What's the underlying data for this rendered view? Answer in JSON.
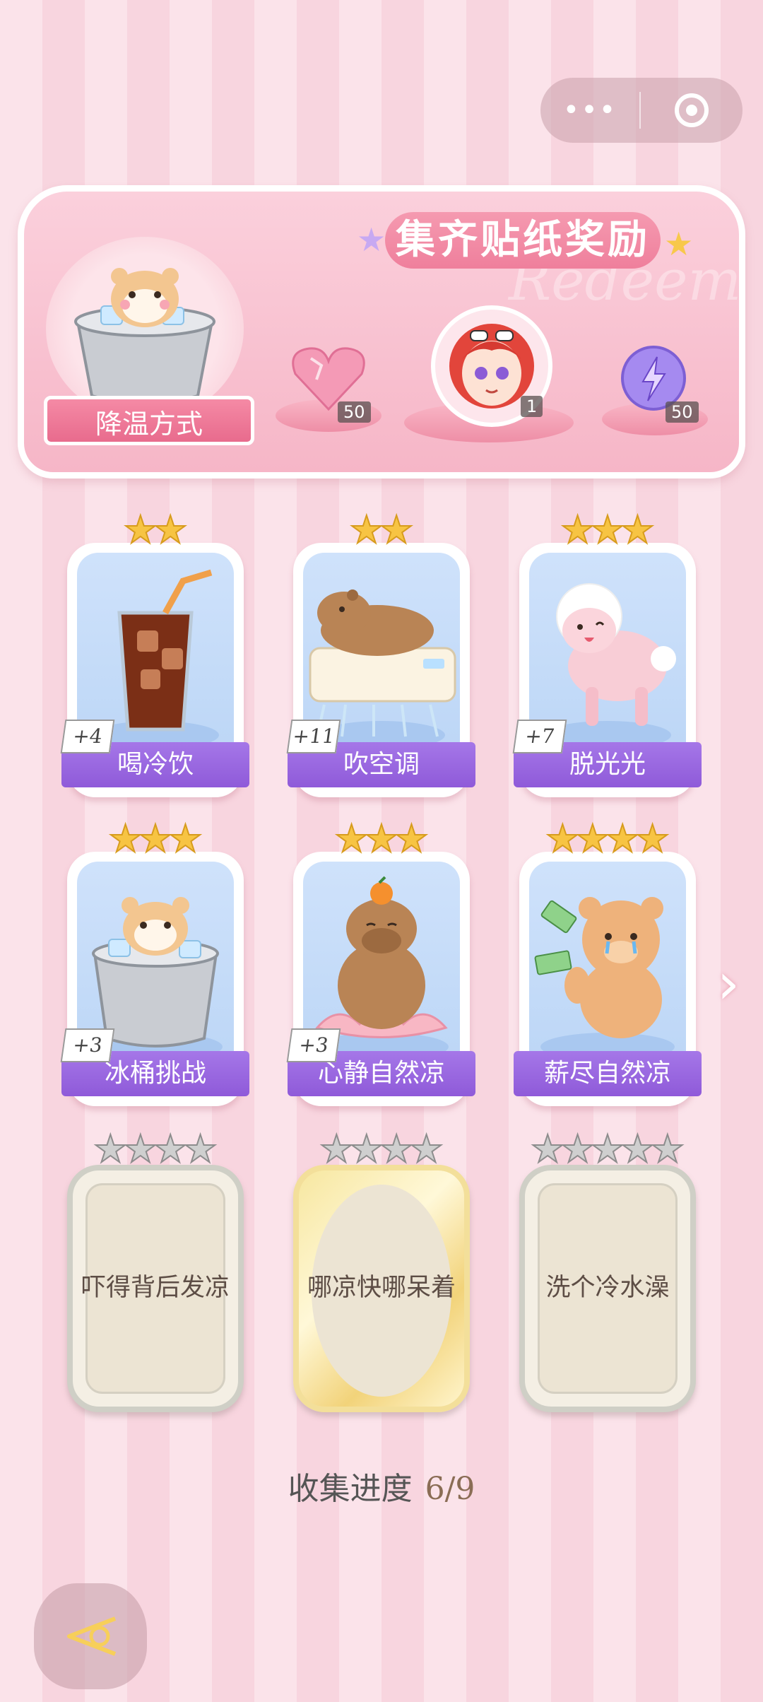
{
  "top_capsule": {
    "more_glyph": "•••"
  },
  "banner": {
    "title": "集齐贴纸奖励",
    "watermark": "Redeem",
    "cooling_label": "降温方式",
    "rewards": [
      {
        "name": "pink-heart-gem",
        "count": "50"
      },
      {
        "name": "character-avatar",
        "count": "1"
      },
      {
        "name": "lightning-orb",
        "count": "50"
      }
    ]
  },
  "cards": [
    {
      "name": "喝冷饮",
      "bonus": "+4",
      "stars": 2,
      "icon": "iced-drink-icon"
    },
    {
      "name": "吹空调",
      "bonus": "+11",
      "stars": 2,
      "icon": "capybara-aircon-icon"
    },
    {
      "name": "脱光光",
      "bonus": "+7",
      "stars": 3,
      "icon": "sheep-icon"
    },
    {
      "name": "冰桶挑战",
      "bonus": "+3",
      "stars": 3,
      "icon": "hamster-ice-bucket-icon"
    },
    {
      "name": "心静自然凉",
      "bonus": "+3",
      "stars": 3,
      "icon": "capybara-lotus-icon"
    },
    {
      "name": "薪尽自然凉",
      "bonus": "",
      "stars": 4,
      "icon": "crying-bear-icon"
    }
  ],
  "locked_cards": [
    {
      "name": "吓得背后发凉",
      "stars": 4
    },
    {
      "name": "哪凉快哪呆着",
      "stars": 4
    },
    {
      "name": "洗个冷水澡",
      "stars": 5
    }
  ],
  "progress": {
    "label": "收集进度",
    "value": "6/9"
  },
  "colors": {
    "card_banner": "#9b66df",
    "star_gold": "#f7c443",
    "accent_pink": "#f58aa5"
  }
}
